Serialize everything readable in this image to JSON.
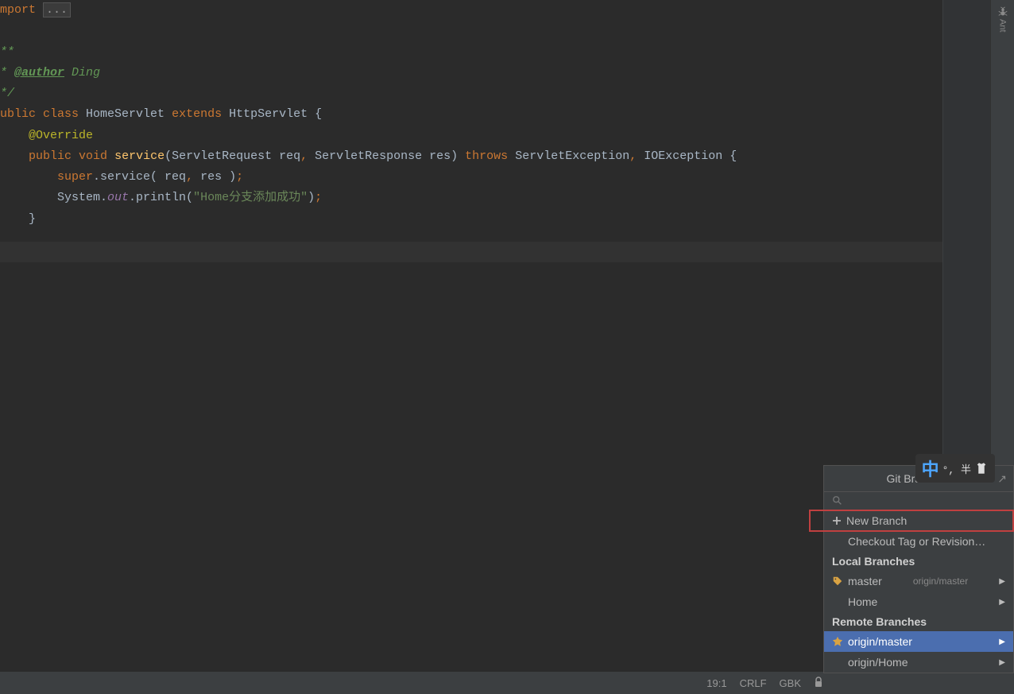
{
  "code": {
    "l0_import": "mport",
    "l0_fold": "...",
    "l1_a": "**",
    "l2_a": "* ",
    "l2_tag": "@author",
    "l2_b": " Ding",
    "l3_a": "*/",
    "l4_a": "ublic class",
    "l4_b": " HomeServlet ",
    "l4_c": "extends",
    "l4_d": " HttpServlet {",
    "l5_a": "    ",
    "l5_b": "@Override",
    "l6_a": "    ",
    "l6_b": "public void",
    "l6_c": " ",
    "l6_d": "service",
    "l6_e": "(ServletRequest req",
    "l6_comma1": ",",
    "l6_f": " ServletResponse res) ",
    "l6_g": "throws",
    "l6_h": " ServletException",
    "l6_comma2": ",",
    "l6_i": " IOException {",
    "l7_a": "        ",
    "l7_b": "super",
    "l7_c": ".service( req",
    "l7_comma": ",",
    "l7_d": " res )",
    "l7_semi": ";",
    "l8_a": "        System.",
    "l8_b": "out",
    "l8_c": ".println(",
    "l8_d": "\"Home分支添加成功\"",
    "l8_e": ")",
    "l8_semi": ";",
    "l9_a": "    }"
  },
  "gitPopup": {
    "title": "Git Branches",
    "newBranch": "New Branch",
    "checkoutTag": "Checkout Tag or Revision…",
    "localBranches": "Local Branches",
    "master": "master",
    "masterTracking": "origin/master",
    "home": "Home",
    "remoteBranches": "Remote Branches",
    "originMaster": "origin/master",
    "originHome": "origin/Home"
  },
  "statusBar": {
    "position": "19:1",
    "lineEnding": "CRLF",
    "encoding": "GBK"
  },
  "rightPanel": {
    "ant": "Ant"
  },
  "ime": {
    "zhong": "中",
    "rest": "°, 半"
  }
}
